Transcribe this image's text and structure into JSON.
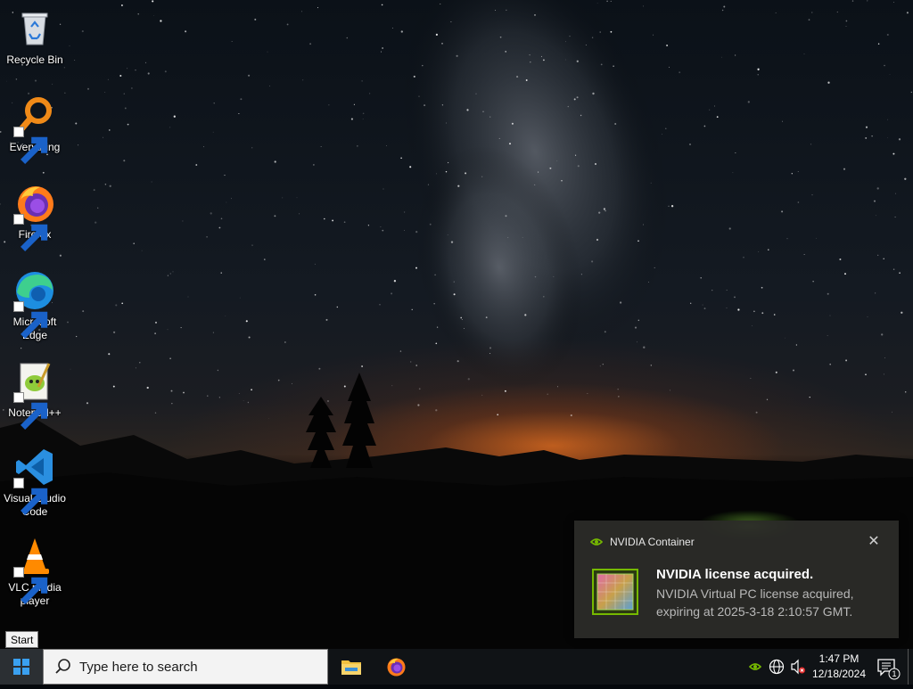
{
  "desktop": {
    "icons": [
      {
        "label": "Recycle Bin",
        "icon": "recycle-bin-icon"
      },
      {
        "label": "Everything",
        "icon": "everything-icon"
      },
      {
        "label": "Firefox",
        "icon": "firefox-icon"
      },
      {
        "label": "Microsoft Edge",
        "icon": "edge-icon"
      },
      {
        "label": "Notepad++",
        "icon": "notepadpp-icon"
      },
      {
        "label": "Visual Studio Code",
        "icon": "vscode-icon"
      },
      {
        "label": "VLC media player",
        "icon": "vlc-icon"
      }
    ]
  },
  "tooltip": {
    "text": "Start"
  },
  "notification": {
    "app_name": "NVIDIA Container",
    "title": "NVIDIA license acquired.",
    "body": "NVIDIA Virtual PC license acquired, expiring at 2025-3-18 2:10:57 GMT.",
    "close_icon": "close-icon",
    "accent": "#76b900"
  },
  "taskbar": {
    "search_placeholder": "Type here to search",
    "pinned": [
      {
        "name": "File Explorer",
        "icon": "folder-icon"
      },
      {
        "name": "Firefox",
        "icon": "firefox-icon"
      }
    ],
    "tray": {
      "icons": [
        "nvidia-icon",
        "network-icon",
        "volume-muted-icon"
      ],
      "time": "1:47 PM",
      "date": "12/18/2024",
      "notification_count": "1"
    }
  }
}
